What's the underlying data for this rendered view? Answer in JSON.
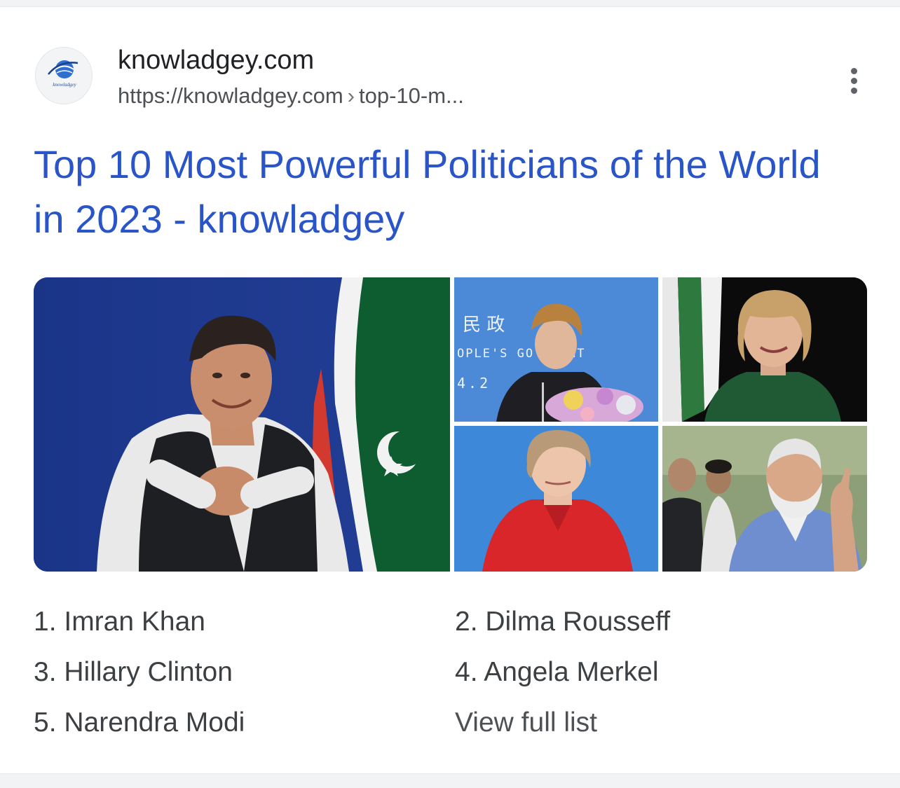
{
  "header": {
    "site_name": "knowladgey.com",
    "url_base": "https://knowladgey.com",
    "url_separator": "›",
    "url_path": "top-10-m...",
    "favicon_text": "knowladgey"
  },
  "result": {
    "title": "Top 10 Most Powerful Politicians of the World in 2023 - knowladgey"
  },
  "images": {
    "img2_sign_line1": "民 政",
    "img2_sign_line2": "OPLE'S GO   NMENT",
    "img2_sign_line3": "4.2"
  },
  "list": {
    "items": [
      "1. Imran Khan",
      "2. Dilma Rousseff",
      "3. Hillary Clinton",
      "4. Angela Merkel",
      "5. Narendra Modi"
    ],
    "view_full": "View full list"
  },
  "colors": {
    "title_link": "#2a55c8",
    "text_primary": "#202124",
    "text_secondary": "#4d5156"
  },
  "icons": {
    "menu": "more-vert-icon",
    "favicon": "globe-icon"
  }
}
